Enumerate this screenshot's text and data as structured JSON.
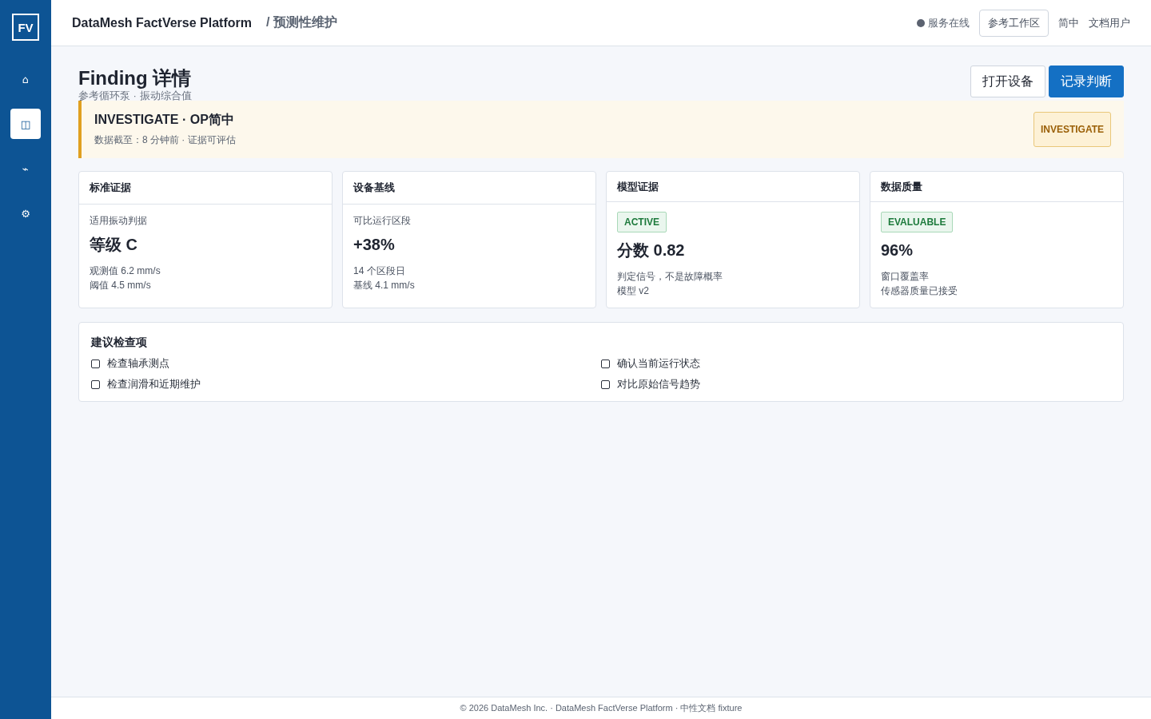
{
  "sidebar": {
    "logo": "FV",
    "items": [
      {
        "icon": "⌂",
        "selected": false
      },
      {
        "icon": "◫",
        "selected": true
      },
      {
        "icon": "⌁",
        "selected": false
      },
      {
        "icon": "⚙",
        "selected": false
      }
    ]
  },
  "header": {
    "brand": "DataMesh FactVerse Platform",
    "breadcrumb": "/ 预测性维护",
    "status": "服务在线",
    "workspace_button": "参考工作区",
    "language": "简中",
    "user": "文档用户"
  },
  "page": {
    "title": "Finding 详情",
    "subtitle": "参考循环泵 · 振动综合值",
    "buttons": [
      {
        "label": "打开设备",
        "primary": false
      },
      {
        "label": "记录判断",
        "primary": true
      }
    ]
  },
  "banner": {
    "title": "INVESTIGATE · OP简中",
    "detail": "数据截至：8 分钟前 · 证据可评估",
    "badge": "INVESTIGATE"
  },
  "cards": [
    {
      "title": "标准证据",
      "caption": "适用振动判据",
      "value": "等级 C",
      "lines": [
        "观测值 6.2 mm/s",
        "阈值 4.5 mm/s"
      ]
    },
    {
      "title": "设备基线",
      "caption": "可比运行区段",
      "value": "+38%",
      "lines": [
        "14 个区段日",
        "基线 4.1 mm/s"
      ]
    },
    {
      "title": "模型证据",
      "badge": "ACTIVE",
      "value": "分数 0.82",
      "lines": [
        "判定信号，不是故障概率",
        "模型 v2"
      ]
    },
    {
      "title": "数据质量",
      "badge": "EVALUABLE",
      "value": "96%",
      "lines": [
        "窗口覆盖率",
        "传感器质量已接受"
      ]
    }
  ],
  "checklist": {
    "title": "建议检查项",
    "items": [
      {
        "label": "检查轴承测点",
        "checked": false
      },
      {
        "label": "确认当前运行状态",
        "checked": false
      },
      {
        "label": "检查润滑和近期维护",
        "checked": false
      },
      {
        "label": "对比原始信号趋势",
        "checked": false
      }
    ]
  },
  "footer": "© 2026 DataMesh Inc. · DataMesh FactVerse Platform · 中性文档 fixture"
}
